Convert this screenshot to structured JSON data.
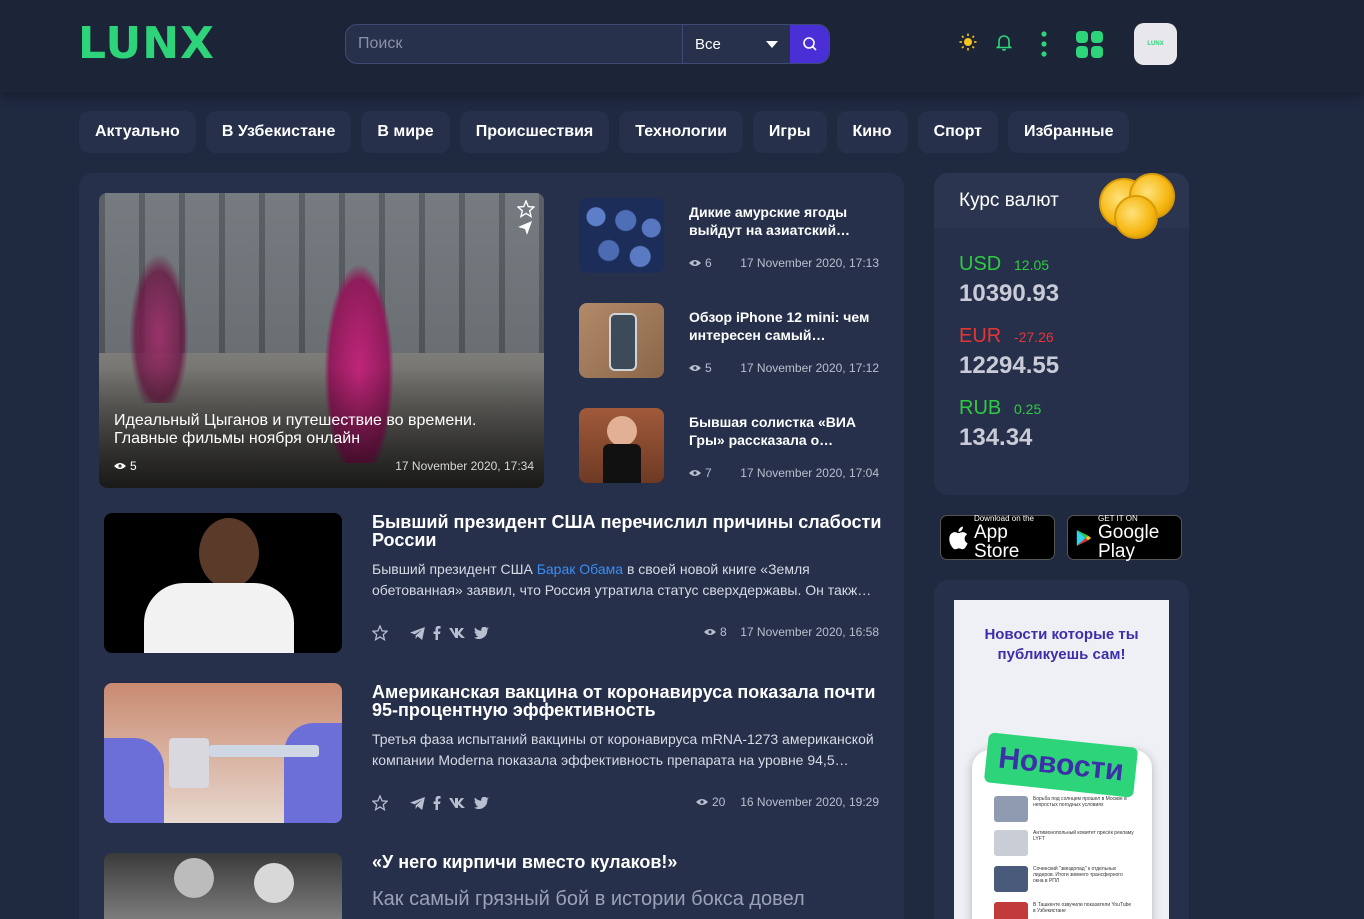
{
  "header": {
    "logo": "LUNX",
    "search_placeholder": "Поиск",
    "search_scope": "Все",
    "avatar_text": "LUNX"
  },
  "tabs": [
    "Актуально",
    "В Узбекистане",
    "В мире",
    "Происшествия",
    "Технологии",
    "Игры",
    "Кино",
    "Спорт",
    "Избранные"
  ],
  "hero": {
    "title": "Идеальный Цыганов и путешествие во времени. Главные фильмы ноября онлайн",
    "views": "5",
    "date": "17 November 2020, 17:34"
  },
  "side_news": [
    {
      "title": "Дикие амурские ягоды выйдут на азиатский…",
      "views": "6",
      "date": "17 November 2020, 17:13"
    },
    {
      "title": "Обзор iPhone 12 mini: чем интересен самый…",
      "views": "5",
      "date": "17 November 2020, 17:12"
    },
    {
      "title": "Бывшая солистка «ВИА Гры» рассказала о…",
      "views": "7",
      "date": "17 November 2020, 17:04"
    }
  ],
  "articles": [
    {
      "title": "Бывший президент США перечислил причины слабости России",
      "text_before": "Бывший президент США ",
      "link": "Барак Обама",
      "text_after": " в своей новой книге «Земля обетованная» заявил, что Россия утратила статус сверхдержавы. Он такж…",
      "views": "8",
      "date": "17 November 2020, 16:58"
    },
    {
      "title": "Американская вакцина от коронавируса показала почти 95-процентную эффективность",
      "text_before": "Третья фаза испытаний вакцины от коронавируса mRNA-1273 американской компании Moderna показала эффективность препарата на уровне 94,5…",
      "link": "",
      "text_after": "",
      "views": "20",
      "date": "16 November 2020, 19:29"
    },
    {
      "title": "«У него кирпичи вместо кулаков!»",
      "subtitle": "Как самый грязный бой в истории бокса довел"
    }
  ],
  "currency": {
    "title": "Курс валют",
    "rates": [
      {
        "code": "USD",
        "change": "12.05",
        "value": "10390.93",
        "color": "#2ecc40"
      },
      {
        "code": "EUR",
        "change": "-27.26",
        "value": "12294.55",
        "color": "#e53535"
      },
      {
        "code": "RUB",
        "change": "0.25",
        "value": "134.34",
        "color": "#2ecc40"
      }
    ]
  },
  "stores": {
    "apple_small": "Download on the",
    "apple_big": "App Store",
    "google_small": "GET IT ON",
    "google_big": "Google Play"
  },
  "promo": {
    "title": "Новости которые ты публикуешь сам!",
    "badge": "Новости",
    "items": [
      "Борьба под солнцем прошел в Москве в непростых погодных условиях",
      "Антимонопольный комитет пресёк рекламу LYFT",
      "Сочинский \"звездопад\" к отдельных лидеров. Итоги зимнего трансферного окна в РПЛ",
      "В Ташкенте озвучили показатели YouTube в Узбекистане"
    ]
  },
  "colors": {
    "accent": "#2ed47a",
    "search_button": "#4a2fd6",
    "panel": "#26304a",
    "bg": "#1f2940"
  }
}
